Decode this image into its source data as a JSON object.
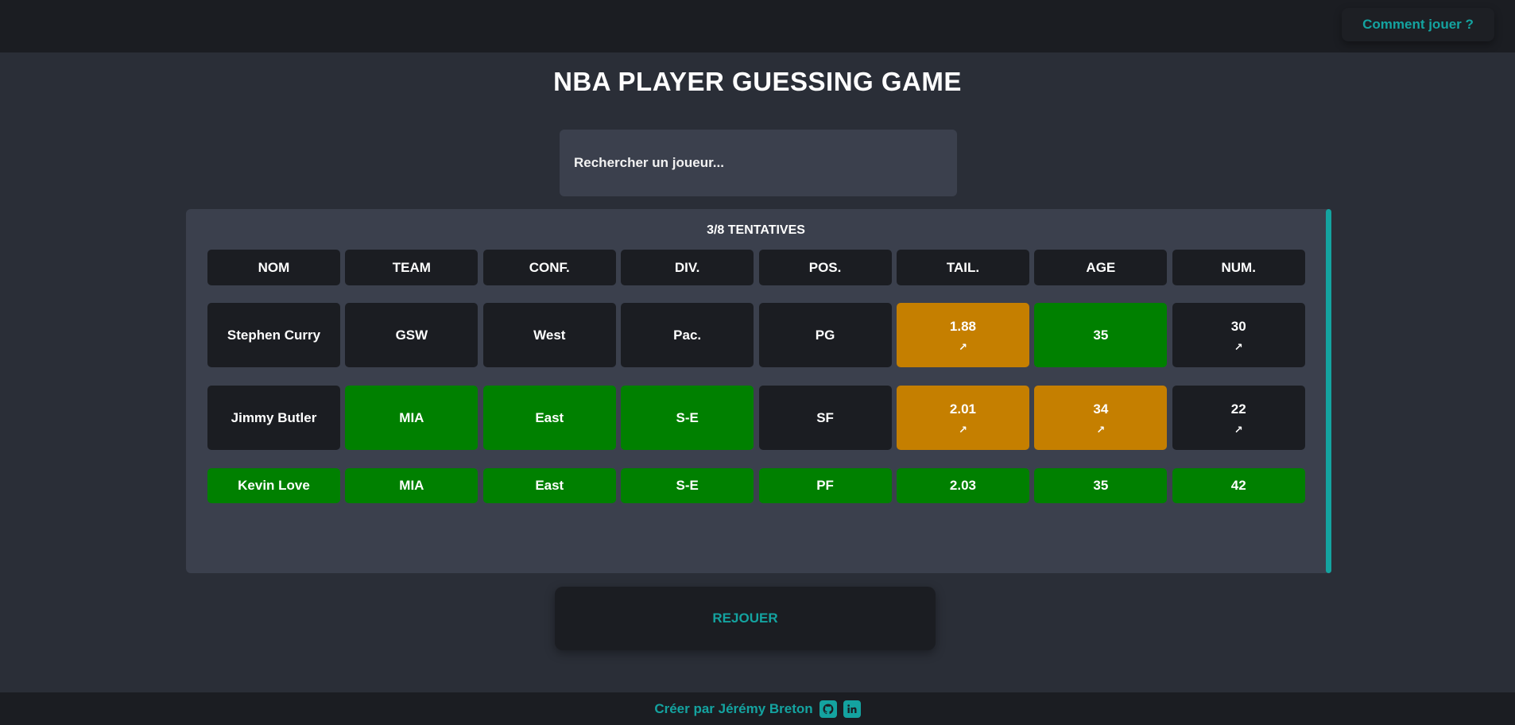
{
  "header": {
    "help_label": "Comment jouer ?"
  },
  "title": "NBA PLAYER GUESSING GAME",
  "search": {
    "placeholder": "Rechercher un joueur..."
  },
  "board": {
    "attempts": "3/8 TENTATIVES",
    "columns": [
      "NOM",
      "TEAM",
      "CONF.",
      "DIV.",
      "POS.",
      "TAIL.",
      "AGE",
      "NUM."
    ],
    "rows": [
      {
        "cells": [
          {
            "value": "Stephen Curry",
            "status": "none",
            "arrow": ""
          },
          {
            "value": "GSW",
            "status": "none",
            "arrow": ""
          },
          {
            "value": "West",
            "status": "none",
            "arrow": ""
          },
          {
            "value": "Pac.",
            "status": "none",
            "arrow": ""
          },
          {
            "value": "PG",
            "status": "none",
            "arrow": ""
          },
          {
            "value": "1.88",
            "status": "close",
            "arrow": "↗"
          },
          {
            "value": "35",
            "status": "correct",
            "arrow": ""
          },
          {
            "value": "30",
            "status": "none",
            "arrow": "↗"
          }
        ]
      },
      {
        "cells": [
          {
            "value": "Jimmy Butler",
            "status": "none",
            "arrow": ""
          },
          {
            "value": "MIA",
            "status": "correct",
            "arrow": ""
          },
          {
            "value": "East",
            "status": "correct",
            "arrow": ""
          },
          {
            "value": "S-E",
            "status": "correct",
            "arrow": ""
          },
          {
            "value": "SF",
            "status": "none",
            "arrow": ""
          },
          {
            "value": "2.01",
            "status": "close",
            "arrow": "↗"
          },
          {
            "value": "34",
            "status": "close",
            "arrow": "↗"
          },
          {
            "value": "22",
            "status": "none",
            "arrow": "↗"
          }
        ]
      },
      {
        "cells": [
          {
            "value": "Kevin Love",
            "status": "correct",
            "arrow": ""
          },
          {
            "value": "MIA",
            "status": "correct",
            "arrow": ""
          },
          {
            "value": "East",
            "status": "correct",
            "arrow": ""
          },
          {
            "value": "S-E",
            "status": "correct",
            "arrow": ""
          },
          {
            "value": "PF",
            "status": "correct",
            "arrow": ""
          },
          {
            "value": "2.03",
            "status": "correct",
            "arrow": ""
          },
          {
            "value": "35",
            "status": "correct",
            "arrow": ""
          },
          {
            "value": "42",
            "status": "correct",
            "arrow": ""
          }
        ]
      }
    ]
  },
  "replay_label": "REJOUER",
  "footer": {
    "credit": "Créer par Jérémy Breton",
    "icons": [
      "github-icon",
      "linkedin-icon"
    ]
  },
  "colors": {
    "accent": "#14a3a0",
    "correct": "#008000",
    "close": "#c57f00",
    "cell": "#1b1d22",
    "panel": "#3b404d",
    "background": "#2a2e37"
  }
}
